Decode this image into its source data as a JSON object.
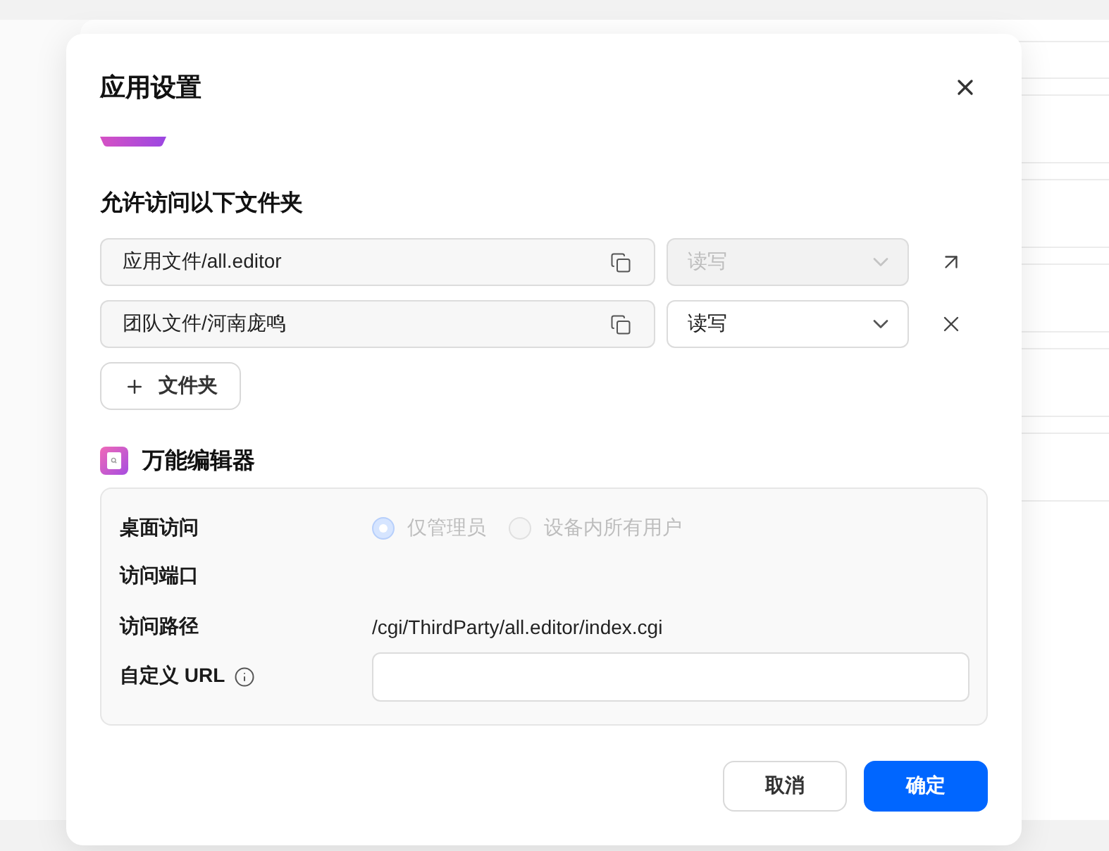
{
  "dialog": {
    "title": "应用设置"
  },
  "folders_section": {
    "heading": "允许访问以下文件夹",
    "folders": [
      {
        "path": "应用文件/all.editor",
        "permission": "读写",
        "disabled": true,
        "kind": "open"
      },
      {
        "path": "团队文件/河南庞鸣",
        "permission": "读写",
        "disabled": false,
        "kind": "remove"
      }
    ],
    "add_button": "文件夹"
  },
  "app": {
    "name": "万能编辑器",
    "settings": [
      {
        "kind": "radio",
        "label": "桌面访问",
        "disabled": true,
        "options": [
          {
            "label": "仅管理员",
            "selected": true
          },
          {
            "label": "设备内所有用户",
            "selected": false
          }
        ]
      },
      {
        "kind": "label",
        "label": "访问端口"
      },
      {
        "kind": "text",
        "label": "访问路径",
        "value": "/cgi/ThirdParty/all.editor/index.cgi"
      },
      {
        "kind": "input",
        "label": "自定义 URL",
        "info": true
      }
    ]
  },
  "buttons": [
    {
      "label": "取消",
      "kind": "secondary"
    },
    {
      "label": "确定",
      "kind": "primary"
    }
  ]
}
